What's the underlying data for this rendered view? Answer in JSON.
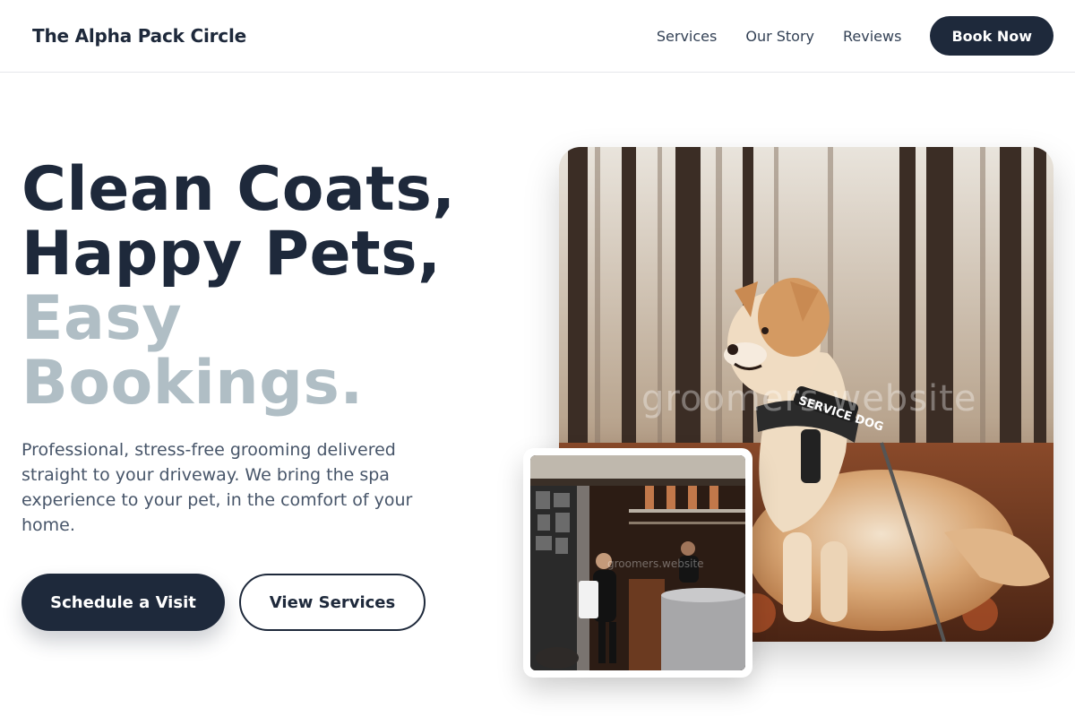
{
  "brand": {
    "name": "The Alpha Pack Circle"
  },
  "nav": {
    "links": [
      "Services",
      "Our Story",
      "Reviews"
    ],
    "cta_label": "Book Now"
  },
  "hero": {
    "title_lines": [
      "Clean Coats,",
      "Happy Pets,",
      "Easy",
      "Bookings."
    ],
    "subtitle": "Professional, stress-free grooming delivered straight to your driveway. We bring the spa experience to your pet, in the comfort of your home.",
    "primary_cta": "Schedule a Visit",
    "secondary_cta": "View Services"
  },
  "images": {
    "main_watermark": "groomers.website",
    "main_harness_text": "SERVICE DOG",
    "small_watermark": "groomers.website"
  },
  "colors": {
    "primary": "#1e293b",
    "muted_heading": "#b0bec5",
    "body_text": "#475569"
  }
}
